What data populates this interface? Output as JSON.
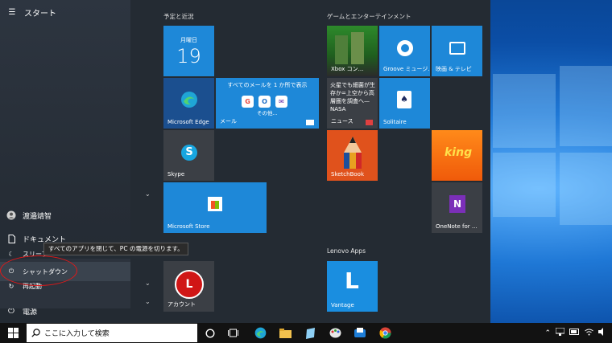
{
  "start_menu": {
    "title": "スタート",
    "user": "渡邉靖智",
    "documents": "ドキュメント",
    "power": "電源",
    "power_menu": {
      "sleep": "スリープ",
      "shutdown": "シャットダウン",
      "restart": "再起動",
      "tooltip": "すべてのアプリを閉じて、PC の電源を切ります。"
    }
  },
  "groups": {
    "plans": "予定と近況",
    "games": "ゲームとエンターテインメント",
    "lenovo": "Lenovo Apps"
  },
  "tiles": {
    "calendar_day": "月曜日",
    "calendar_date": "19",
    "mail_head": "すべてのメールを 1 か所で表示",
    "mail_sub": "その他...",
    "mail": "メール",
    "edge": "Microsoft Edge",
    "skype": "Skype",
    "store": "Microsoft Store",
    "account": "アカウント",
    "xbox": "Xbox コン...",
    "groove": "Groove ミュージ...",
    "movies": "映画 & テレビ",
    "news_text": "火星でも細菌が生存か=上空から高層圏を調査へ—NASA",
    "news": "ニュース",
    "solitaire": "Solitaire",
    "sketchbook": "SketchBook",
    "onenote": "OneNote for ...",
    "vantage": "Vantage"
  },
  "taskbar": {
    "search_placeholder": "ここに入力して検索"
  }
}
